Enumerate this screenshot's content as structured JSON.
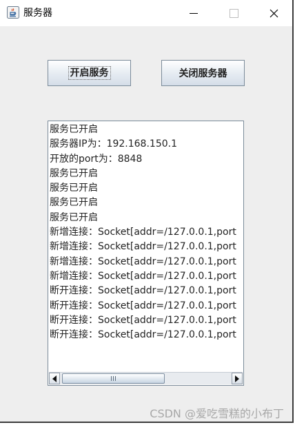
{
  "window": {
    "title": "服务器"
  },
  "titlebar": {
    "minimize_glyph": "—",
    "close_glyph": "✕",
    "icons": [
      "java-app-icon",
      "minimize-icon",
      "maximize-icon",
      "close-icon"
    ]
  },
  "toolbar": {
    "start_label": "开启服务",
    "stop_label": "关闭服务器"
  },
  "log": {
    "lines": [
      "服务已开启",
      "服务器IP为：192.168.150.1",
      "开放的port为：8848",
      "服务已开启",
      "服务已开启",
      "服务已开启",
      "服务已开启",
      "新增连接：Socket[addr=/127.0.0.1,port",
      "新增连接：Socket[addr=/127.0.0.1,port",
      "新增连接：Socket[addr=/127.0.0.1,port",
      "新增连接：Socket[addr=/127.0.0.1,port",
      "断开连接：Socket[addr=/127.0.0.1,port",
      "断开连接：Socket[addr=/127.0.0.1,port",
      "断开连接：Socket[addr=/127.0.0.1,port",
      "断开连接：Socket[addr=/127.0.0.1,port"
    ]
  },
  "watermark": "CSDN @爱吃雪糕的小布丁",
  "colors": {
    "window_bg": "#eeeeee",
    "button_border": "#7a8a99",
    "text": "#222222"
  }
}
